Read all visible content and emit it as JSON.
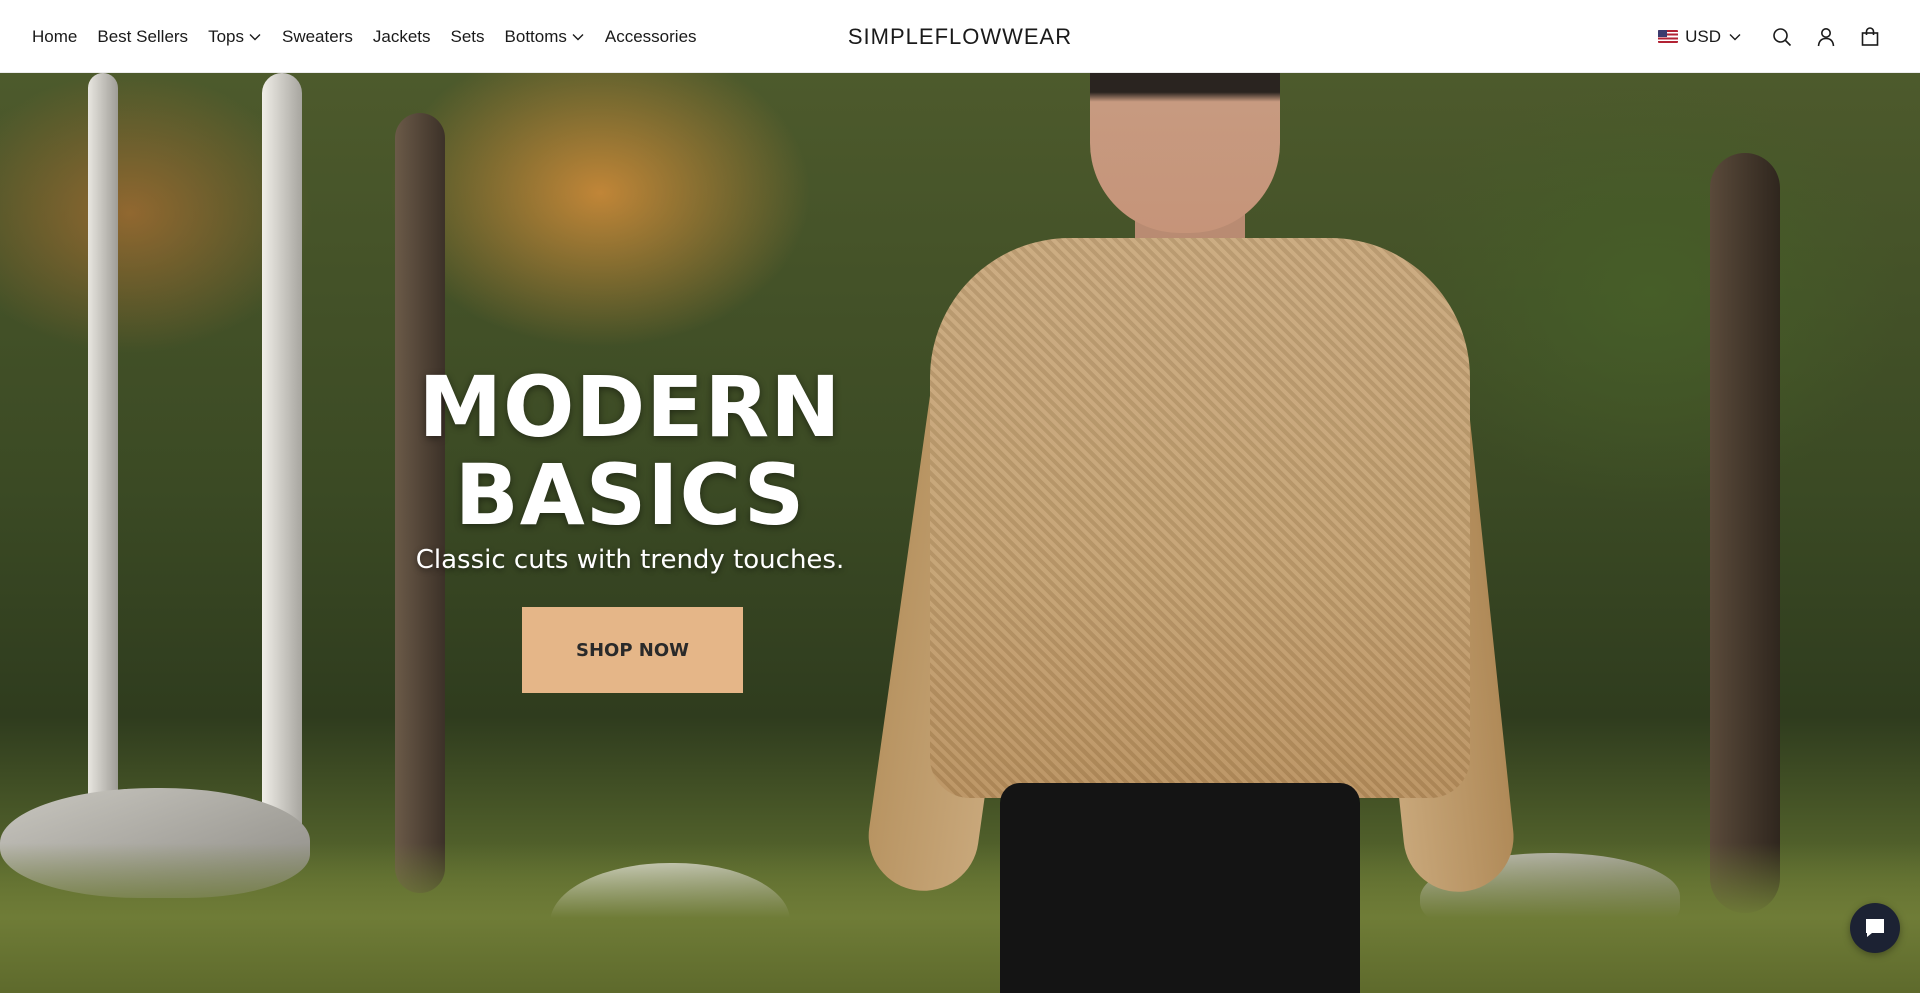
{
  "header": {
    "nav": [
      {
        "label": "Home",
        "has_dropdown": false
      },
      {
        "label": "Best Sellers",
        "has_dropdown": false
      },
      {
        "label": "Tops",
        "has_dropdown": true
      },
      {
        "label": "Sweaters",
        "has_dropdown": false
      },
      {
        "label": "Jackets",
        "has_dropdown": false
      },
      {
        "label": "Sets",
        "has_dropdown": false
      },
      {
        "label": "Bottoms",
        "has_dropdown": true
      },
      {
        "label": "Accessories",
        "has_dropdown": false
      }
    ],
    "logo": "SIMPLEFLOWWEAR",
    "currency": {
      "code": "USD",
      "flag": "us-flag-icon"
    },
    "icons": [
      "search-icon",
      "account-icon",
      "cart-icon"
    ]
  },
  "hero": {
    "title_line1": "MODERN",
    "title_line2": "BASICS",
    "subtitle": "Classic cuts with trendy touches.",
    "cta": "SHOP NOW",
    "cta_color": "#e5b688"
  },
  "chat": {
    "icon": "chat-icon",
    "color": "#1c2233"
  }
}
